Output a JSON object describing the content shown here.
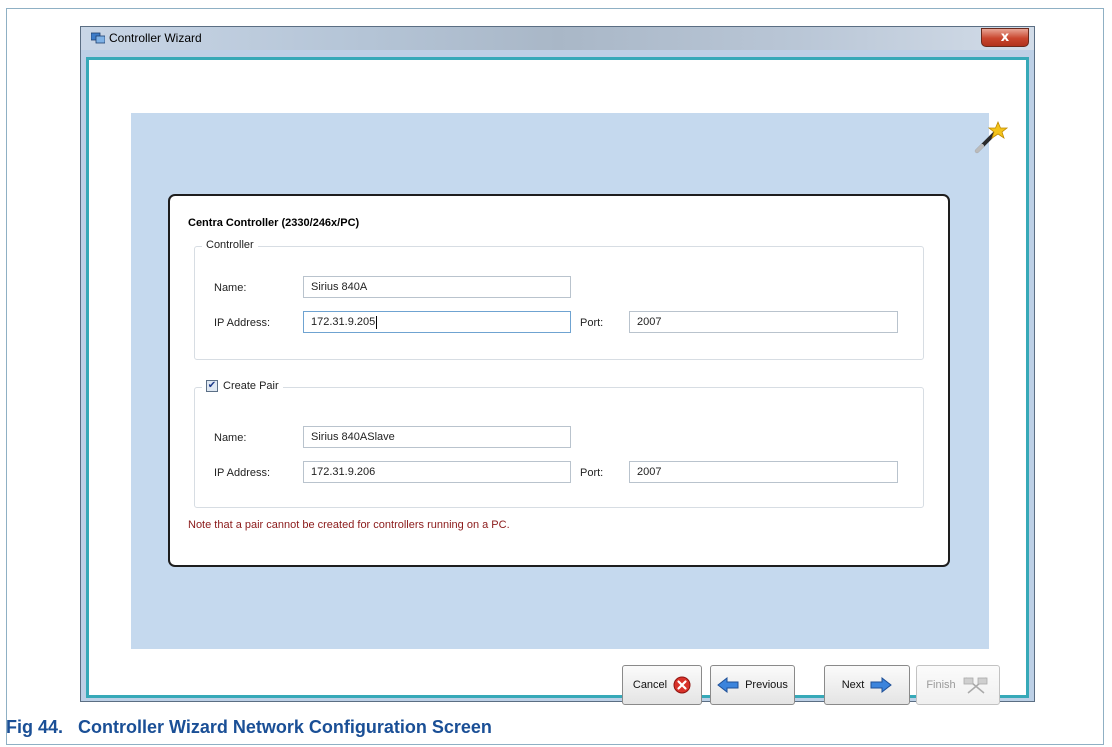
{
  "window": {
    "title": "Controller Wizard",
    "close_label": "x"
  },
  "card": {
    "title": "Centra Controller (2330/246x/PC)",
    "controller_group": {
      "legend": "Controller",
      "name_label": "Name:",
      "name_value": "Sirius 840A",
      "ip_label": "IP Address:",
      "ip_value": "172.31.9.205",
      "port_label": "Port:",
      "port_value": "2007"
    },
    "pair_group": {
      "legend": "Create Pair",
      "checked": true,
      "check_mark": "✔",
      "name_label": "Name:",
      "name_value": "Sirius 840ASlave",
      "ip_label": "IP Address:",
      "ip_value": "172.31.9.206",
      "port_label": "Port:",
      "port_value": "2007"
    },
    "note": "Note that a pair cannot be created for controllers running on a PC."
  },
  "buttons": {
    "cancel": "Cancel",
    "previous": "Previous",
    "next": "Next",
    "finish": "Finish"
  },
  "icons": {
    "app": "controller-wizard-icon",
    "wand": "magic-wand-icon",
    "cancel": "cancel-x-icon",
    "previous": "arrow-left-icon",
    "next": "arrow-right-icon",
    "finish": "checkered-flags-icon"
  },
  "colors": {
    "accent_border": "#36a9b8",
    "panel": "#c5d9ee",
    "note": "#8b1a1a",
    "caption": "#1a4f96"
  },
  "caption": "Fig 44.   Controller Wizard Network Configuration Screen"
}
